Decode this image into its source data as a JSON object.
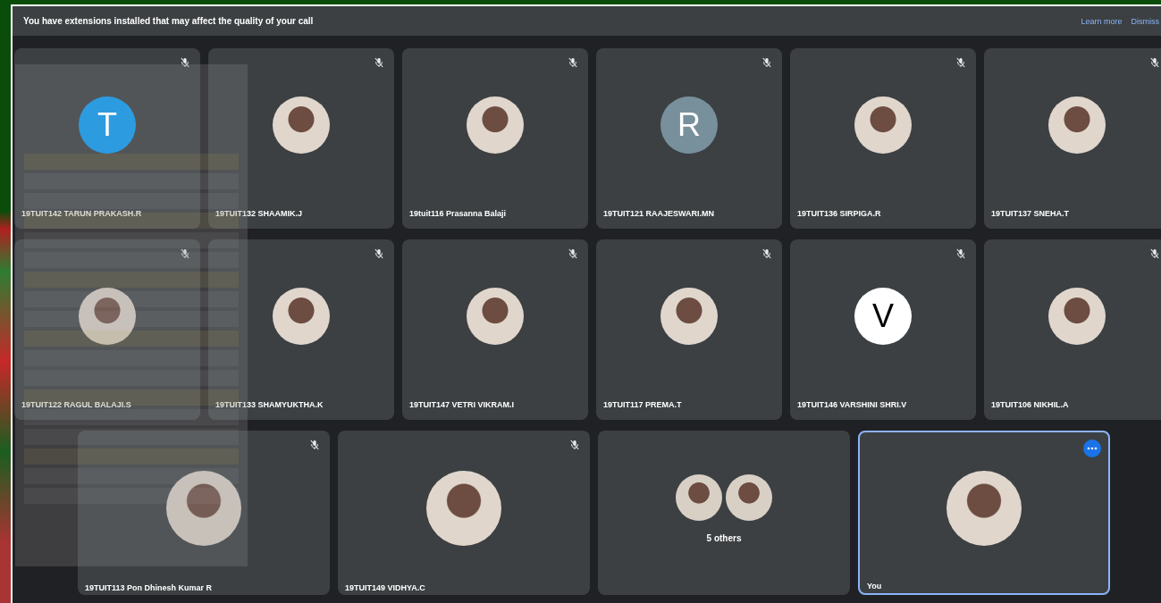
{
  "banner": {
    "message": "You have extensions installed that may affect the quality of your call",
    "links": [
      "Learn more",
      "Dismiss"
    ]
  },
  "rows": [
    {
      "tiles": [
        {
          "kind": "letter",
          "letter": "T",
          "color": "#2d9be0",
          "name": "19TUIT142 TARUN PRAKASH.R",
          "muted": true,
          "selected": false
        },
        {
          "kind": "photo",
          "name": "19TUIT132 SHAAMIK.J",
          "muted": true,
          "selected": false
        },
        {
          "kind": "photo",
          "name": "19tuit116 Prasanna Balaji",
          "muted": true,
          "selected": false
        },
        {
          "kind": "letter",
          "letter": "R",
          "color": "#78909c",
          "name": "19TUIT121 RAAJESWARI.MN",
          "muted": true,
          "selected": false
        },
        {
          "kind": "photo",
          "name": "19TUIT136 SIRPIGA.R",
          "muted": true,
          "selected": false
        },
        {
          "kind": "photo",
          "name": "19TUIT137 SNEHA.T",
          "muted": true,
          "selected": false
        }
      ]
    },
    {
      "tiles": [
        {
          "kind": "photo",
          "name": "19TUIT122 RAGUL BALAJI.S",
          "muted": true,
          "selected": false
        },
        {
          "kind": "photo",
          "name": "19TUIT133 SHAMYUKTHA.K",
          "muted": true,
          "selected": false
        },
        {
          "kind": "photo",
          "name": "19TUIT147 VETRI VIKRAM.I",
          "muted": true,
          "selected": false
        },
        {
          "kind": "photo",
          "name": "19TUIT117 PREMA.T",
          "muted": true,
          "selected": false
        },
        {
          "kind": "letter",
          "letter": "V",
          "color": "#ffffff",
          "name": "19TUIT146 VARSHINI SHRI.V",
          "muted": true,
          "selected": false
        },
        {
          "kind": "photo",
          "name": "19TUIT106 NIKHIL.A",
          "muted": true,
          "selected": false
        }
      ]
    },
    {
      "tiles": [
        {
          "kind": "photo",
          "name": "19TUIT113 Pon Dhinesh Kumar R",
          "muted": true,
          "selected": false
        },
        {
          "kind": "photo",
          "name": "19TUIT149 VIDHYA.C",
          "muted": true,
          "selected": false
        },
        {
          "kind": "group",
          "caption": "5 others",
          "muted": false,
          "selected": false
        },
        {
          "kind": "photo",
          "name": "You",
          "muted": false,
          "selected": true,
          "more": true
        }
      ]
    }
  ]
}
